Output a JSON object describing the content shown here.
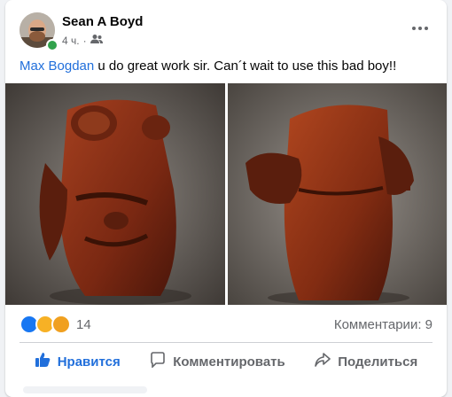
{
  "post": {
    "author": "Sean A Boyd",
    "time": "4 ч.",
    "privacy_icon": "friends-icon",
    "mention": "Max Bogdan",
    "text": " u do great work sir. Can´t wait to use this bad boy!!"
  },
  "reactions": {
    "icons": [
      "like-icon",
      "wow-icon",
      "care-icon"
    ],
    "colors": {
      "like": "#1877f2",
      "wow": "#f7b125",
      "care": "#f7b125"
    },
    "count": "14",
    "comments": "Комментарии: 9"
  },
  "actions": {
    "like": "Нравится",
    "comment": "Комментировать",
    "share": "Поделиться"
  },
  "colors": {
    "accent": "#216fdb",
    "online": "#31a24c",
    "wood": "#8a2f1a"
  }
}
